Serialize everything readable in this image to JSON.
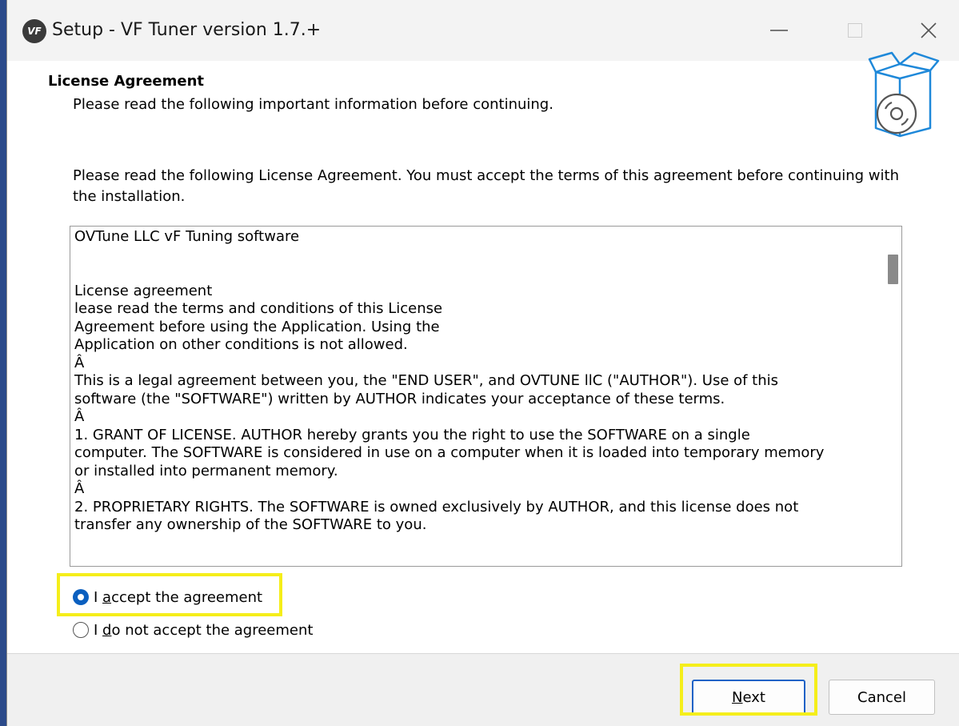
{
  "window": {
    "title": "Setup - VF Tuner version 1.7.+",
    "app_icon_text": "VF"
  },
  "header": {
    "title": "License Agreement",
    "subtitle": "Please read the following important information before continuing."
  },
  "intro": "Please read the following License Agreement. You must accept the terms of this agreement before continuing with the installation.",
  "license": {
    "text": "OVTune LLC vF Tuning software\n\n\nLicense agreement\nlease read the terms and conditions of this License\nAgreement before using the Application. Using the\nApplication on other conditions is not allowed.\nÂ\nThis is a legal agreement between you, the \"END USER\", and OVTUNE llC (\"AUTHOR\"). Use of this\nsoftware (the \"SOFTWARE\") written by AUTHOR indicates your acceptance of these terms.\nÂ\n1. GRANT OF LICENSE. AUTHOR hereby grants you the right to use the SOFTWARE on a single\ncomputer. The SOFTWARE is considered in use on a computer when it is loaded into temporary memory\nor installed into permanent memory.\nÂ\n2. PROPRIETARY RIGHTS. The SOFTWARE is owned exclusively by AUTHOR, and this license does not\ntransfer any ownership of the SOFTWARE to you."
  },
  "options": {
    "accept": {
      "prefix": "I ",
      "mnemonic": "a",
      "rest": "ccept the agreement",
      "checked": true
    },
    "decline": {
      "prefix": "I ",
      "mnemonic": "d",
      "rest": "o not accept the agreement",
      "checked": false
    }
  },
  "buttons": {
    "next": {
      "mnemonic": "N",
      "rest": "ext"
    },
    "cancel": "Cancel"
  },
  "colors": {
    "highlight": "#f5ee1a",
    "accent": "#0a5fbf",
    "graphic": "#1e88d9"
  }
}
